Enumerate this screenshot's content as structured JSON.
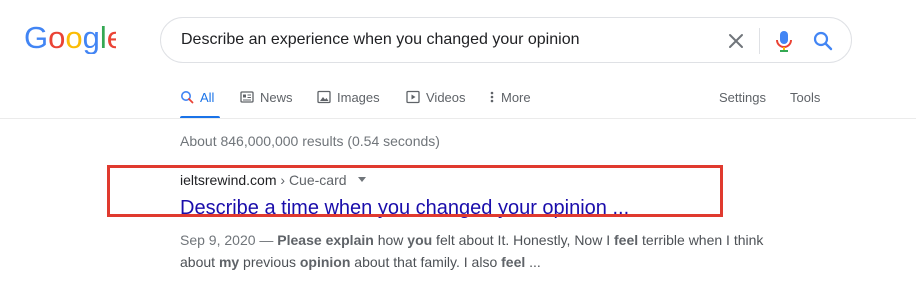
{
  "logo": {
    "text": "Google",
    "letters": [
      "G",
      "o",
      "o",
      "g",
      "l",
      "e"
    ],
    "colors": [
      "#4285f4",
      "#ea4335",
      "#fbbc05",
      "#4285f4",
      "#34a853",
      "#ea4335"
    ]
  },
  "search": {
    "query": "Describe an experience when you changed your opinion",
    "icons": {
      "clear": "close-icon",
      "voice": "microphone-icon",
      "submit": "search-icon"
    }
  },
  "tabs": {
    "items": [
      {
        "label": "All",
        "icon": "search-icon",
        "active": true
      },
      {
        "label": "News",
        "icon": "news-icon"
      },
      {
        "label": "Images",
        "icon": "image-icon"
      },
      {
        "label": "Videos",
        "icon": "play-icon"
      },
      {
        "label": "More",
        "icon": "kebab-icon"
      }
    ],
    "settings": "Settings",
    "tools": "Tools"
  },
  "stats": "About 846,000,000 results (0.54 seconds)",
  "result": {
    "domain": "ieltsrewind.com",
    "separator": "›",
    "path": "Cue-card",
    "title": "Describe a time when you changed your opinion ...",
    "date": "Sep 9, 2020",
    "dash": " — ",
    "snippet_parts": [
      {
        "text": "Please ",
        "bold": true
      },
      {
        "text": "explain",
        "bold": true
      },
      {
        "text": " how ",
        "bold": false
      },
      {
        "text": "you",
        "bold": true
      },
      {
        "text": " felt about It. Honestly, Now I ",
        "bold": false
      },
      {
        "text": "feel",
        "bold": true
      },
      {
        "text": " terrible when I think about ",
        "bold": false
      },
      {
        "text": "my",
        "bold": true
      },
      {
        "text": " previous ",
        "bold": false
      },
      {
        "text": "opinion",
        "bold": true
      },
      {
        "text": " about that family. I also ",
        "bold": false
      },
      {
        "text": "feel",
        "bold": true
      },
      {
        "text": " ...",
        "bold": false
      }
    ]
  },
  "colors": {
    "accent": "#1a73e8",
    "link": "#1a0dab",
    "highlight": "#e03a2f"
  }
}
